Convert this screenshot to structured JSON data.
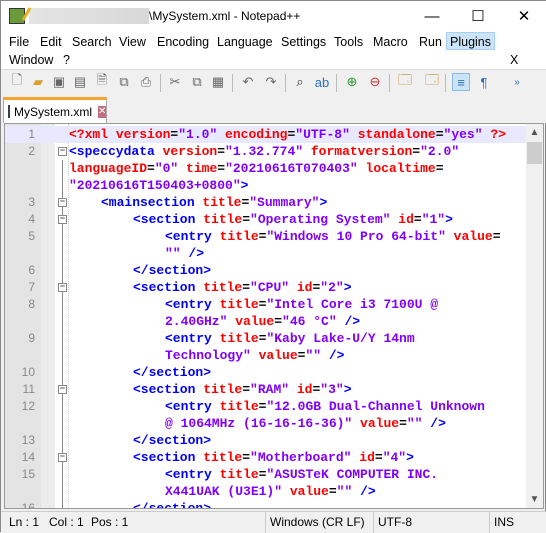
{
  "window": {
    "title": "\\MySystem.xml - Notepad++",
    "minimize": "—",
    "maximize": "☐",
    "close": "✕"
  },
  "menu": [
    "File",
    "Edit",
    "Search",
    "View",
    "Encoding",
    "Language",
    "Settings",
    "Tools",
    "Macro",
    "Run",
    "Plugins",
    "Window",
    "?"
  ],
  "menu_close": "X",
  "toolbar": [
    "new-file",
    "open-file",
    "save",
    "save-all",
    "close",
    "close-all",
    "print",
    "cut",
    "copy",
    "paste",
    "undo",
    "redo",
    "find",
    "replace",
    "zoom-in",
    "zoom-out",
    "sync-vertical",
    "sync-horizontal",
    "word-wrap",
    "show-all-characters",
    "more"
  ],
  "tab": {
    "label": "MySystem.xml",
    "close": "✕"
  },
  "editor": {
    "lines": [
      {
        "n": "1",
        "fold": "",
        "cur": true,
        "indent": 0,
        "t": [
          [
            "pi",
            "<?xml "
          ],
          [
            "attr",
            "version"
          ],
          [
            "op",
            "="
          ],
          [
            "val",
            "\"1.0\" "
          ],
          [
            "attr",
            "encoding"
          ],
          [
            "op",
            "="
          ],
          [
            "val",
            "\"UTF-8\" "
          ],
          [
            "attr",
            "standalone"
          ],
          [
            "op",
            "="
          ],
          [
            "val",
            "\"yes\" "
          ],
          [
            "pi",
            "?>"
          ]
        ]
      },
      {
        "n": "2",
        "fold": "−",
        "indent": 0,
        "t": [
          [
            "tag",
            "<speccydata "
          ],
          [
            "attr",
            "version"
          ],
          [
            "op",
            "="
          ],
          [
            "val",
            "\"1.32.774\" "
          ],
          [
            "attr",
            "formatversion"
          ],
          [
            "op",
            "="
          ],
          [
            "val",
            "\"2.0\""
          ]
        ]
      },
      {
        "n": "",
        "indent": 0,
        "t": [
          [
            "attr",
            "languageID"
          ],
          [
            "op",
            "="
          ],
          [
            "val",
            "\"0\" "
          ],
          [
            "attr",
            "time"
          ],
          [
            "op",
            "="
          ],
          [
            "val",
            "\"20210616T070403\" "
          ],
          [
            "attr",
            "localtime"
          ],
          [
            "op",
            "="
          ]
        ]
      },
      {
        "n": "",
        "indent": 0,
        "t": [
          [
            "val",
            "\"20210616T150403+0800\""
          ],
          [
            "tag",
            ">"
          ]
        ]
      },
      {
        "n": "3",
        "fold": "−",
        "indent": 1,
        "t": [
          [
            "tag",
            "<mainsection "
          ],
          [
            "attr",
            "title"
          ],
          [
            "op",
            "="
          ],
          [
            "val",
            "\"Summary\""
          ],
          [
            "tag",
            ">"
          ]
        ]
      },
      {
        "n": "4",
        "fold": "−",
        "indent": 2,
        "t": [
          [
            "tag",
            "<section "
          ],
          [
            "attr",
            "title"
          ],
          [
            "op",
            "="
          ],
          [
            "val",
            "\"Operating System\" "
          ],
          [
            "attr",
            "id"
          ],
          [
            "op",
            "="
          ],
          [
            "val",
            "\"1\""
          ],
          [
            "tag",
            ">"
          ]
        ]
      },
      {
        "n": "5",
        "indent": 3,
        "t": [
          [
            "tag",
            "<entry "
          ],
          [
            "attr",
            "title"
          ],
          [
            "op",
            "="
          ],
          [
            "val",
            "\"Windows 10 Pro 64-bit\" "
          ],
          [
            "attr",
            "value"
          ],
          [
            "op",
            "="
          ]
        ]
      },
      {
        "n": "",
        "indent": 3,
        "t": [
          [
            "val",
            "\"\" "
          ],
          [
            "tag",
            "/>"
          ]
        ]
      },
      {
        "n": "6",
        "indent": 2,
        "t": [
          [
            "tag",
            "</section>"
          ]
        ]
      },
      {
        "n": "7",
        "fold": "−",
        "indent": 2,
        "t": [
          [
            "tag",
            "<section "
          ],
          [
            "attr",
            "title"
          ],
          [
            "op",
            "="
          ],
          [
            "val",
            "\"CPU\" "
          ],
          [
            "attr",
            "id"
          ],
          [
            "op",
            "="
          ],
          [
            "val",
            "\"2\""
          ],
          [
            "tag",
            ">"
          ]
        ]
      },
      {
        "n": "8",
        "indent": 3,
        "t": [
          [
            "tag",
            "<entry "
          ],
          [
            "attr",
            "title"
          ],
          [
            "op",
            "="
          ],
          [
            "val",
            "\"Intel Core i3 7100U @"
          ]
        ]
      },
      {
        "n": "",
        "indent": 3,
        "t": [
          [
            "val",
            "2.40GHz\" "
          ],
          [
            "attr",
            "value"
          ],
          [
            "op",
            "="
          ],
          [
            "val",
            "\"46 °C\" "
          ],
          [
            "tag",
            "/>"
          ]
        ]
      },
      {
        "n": "9",
        "indent": 3,
        "t": [
          [
            "tag",
            "<entry "
          ],
          [
            "attr",
            "title"
          ],
          [
            "op",
            "="
          ],
          [
            "val",
            "\"Kaby Lake-U/Y 14nm"
          ]
        ]
      },
      {
        "n": "",
        "indent": 3,
        "t": [
          [
            "val",
            "Technology\" "
          ],
          [
            "attr",
            "value"
          ],
          [
            "op",
            "="
          ],
          [
            "val",
            "\"\" "
          ],
          [
            "tag",
            "/>"
          ]
        ]
      },
      {
        "n": "10",
        "indent": 2,
        "t": [
          [
            "tag",
            "</section>"
          ]
        ]
      },
      {
        "n": "11",
        "fold": "−",
        "indent": 2,
        "t": [
          [
            "tag",
            "<section "
          ],
          [
            "attr",
            "title"
          ],
          [
            "op",
            "="
          ],
          [
            "val",
            "\"RAM\" "
          ],
          [
            "attr",
            "id"
          ],
          [
            "op",
            "="
          ],
          [
            "val",
            "\"3\""
          ],
          [
            "tag",
            ">"
          ]
        ]
      },
      {
        "n": "12",
        "indent": 3,
        "t": [
          [
            "tag",
            "<entry "
          ],
          [
            "attr",
            "title"
          ],
          [
            "op",
            "="
          ],
          [
            "val",
            "\"12.0GB Dual-Channel Unknown"
          ]
        ]
      },
      {
        "n": "",
        "indent": 3,
        "t": [
          [
            "val",
            "@ 1064MHz (16-16-16-36)\" "
          ],
          [
            "attr",
            "value"
          ],
          [
            "op",
            "="
          ],
          [
            "val",
            "\"\" "
          ],
          [
            "tag",
            "/>"
          ]
        ]
      },
      {
        "n": "13",
        "indent": 2,
        "t": [
          [
            "tag",
            "</section>"
          ]
        ]
      },
      {
        "n": "14",
        "fold": "−",
        "indent": 2,
        "t": [
          [
            "tag",
            "<section "
          ],
          [
            "attr",
            "title"
          ],
          [
            "op",
            "="
          ],
          [
            "val",
            "\"Motherboard\" "
          ],
          [
            "attr",
            "id"
          ],
          [
            "op",
            "="
          ],
          [
            "val",
            "\"4\""
          ],
          [
            "tag",
            ">"
          ]
        ]
      },
      {
        "n": "15",
        "indent": 3,
        "t": [
          [
            "tag",
            "<entry "
          ],
          [
            "attr",
            "title"
          ],
          [
            "op",
            "="
          ],
          [
            "val",
            "\"ASUSTeK COMPUTER INC."
          ]
        ]
      },
      {
        "n": "",
        "indent": 3,
        "t": [
          [
            "val",
            "X441UAK (U3E1)\" "
          ],
          [
            "attr",
            "value"
          ],
          [
            "op",
            "="
          ],
          [
            "val",
            "\"\" "
          ],
          [
            "tag",
            "/>"
          ]
        ]
      },
      {
        "n": "16",
        "indent": 2,
        "t": [
          [
            "tag",
            "</section>"
          ]
        ]
      }
    ]
  },
  "status": {
    "ln": "Ln : 1",
    "col": "Col : 1",
    "pos": "Pos : 1",
    "eol": "Windows (CR LF)",
    "encoding": "UTF-8",
    "mode": "INS"
  }
}
